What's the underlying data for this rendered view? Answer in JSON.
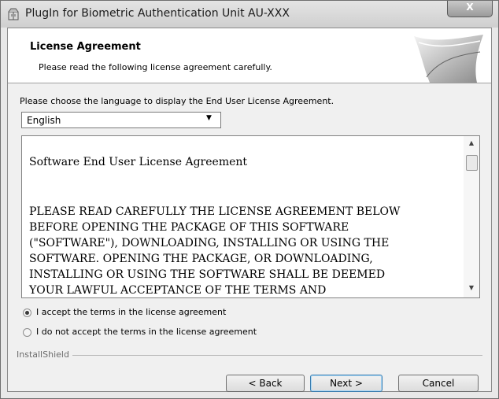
{
  "window": {
    "title": "PlugIn for Biometric Authentication Unit AU-XXX",
    "close_label": "X"
  },
  "banner": {
    "title": "License Agreement",
    "subtitle": "Please read the following license agreement carefully."
  },
  "language": {
    "prompt": "Please choose the language to display the End User License Agreement.",
    "selected": "English"
  },
  "license": {
    "heading": "Software End User License Agreement",
    "lines": [
      "PLEASE READ CAREFULLY THE LICENSE AGREEMENT BELOW",
      "BEFORE OPENING THE PACKAGE OF THIS SOFTWARE",
      "(\"SOFTWARE\"), DOWNLOADING, INSTALLING OR USING THE",
      "SOFTWARE. OPENING THE PACKAGE, OR DOWNLOADING,",
      "INSTALLING OR USING THE SOFTWARE SHALL BE DEEMED",
      "YOUR LAWFUL ACCEPTANCE OF THE TERMS AND"
    ]
  },
  "options": {
    "accept": {
      "label": "I accept the terms in the license agreement",
      "selected": true
    },
    "decline": {
      "label": "I do not accept the terms in the license agreement",
      "selected": false
    }
  },
  "footer": {
    "brand": "InstallShield",
    "back_label": "< Back",
    "next_label": "Next >",
    "cancel_label": "Cancel"
  },
  "icons": {
    "app": "installer-package-icon",
    "close": "close-icon",
    "dropdown": "chevron-down-icon",
    "scroll_up": "scroll-up-arrow-icon",
    "scroll_down": "scroll-down-arrow-icon"
  }
}
